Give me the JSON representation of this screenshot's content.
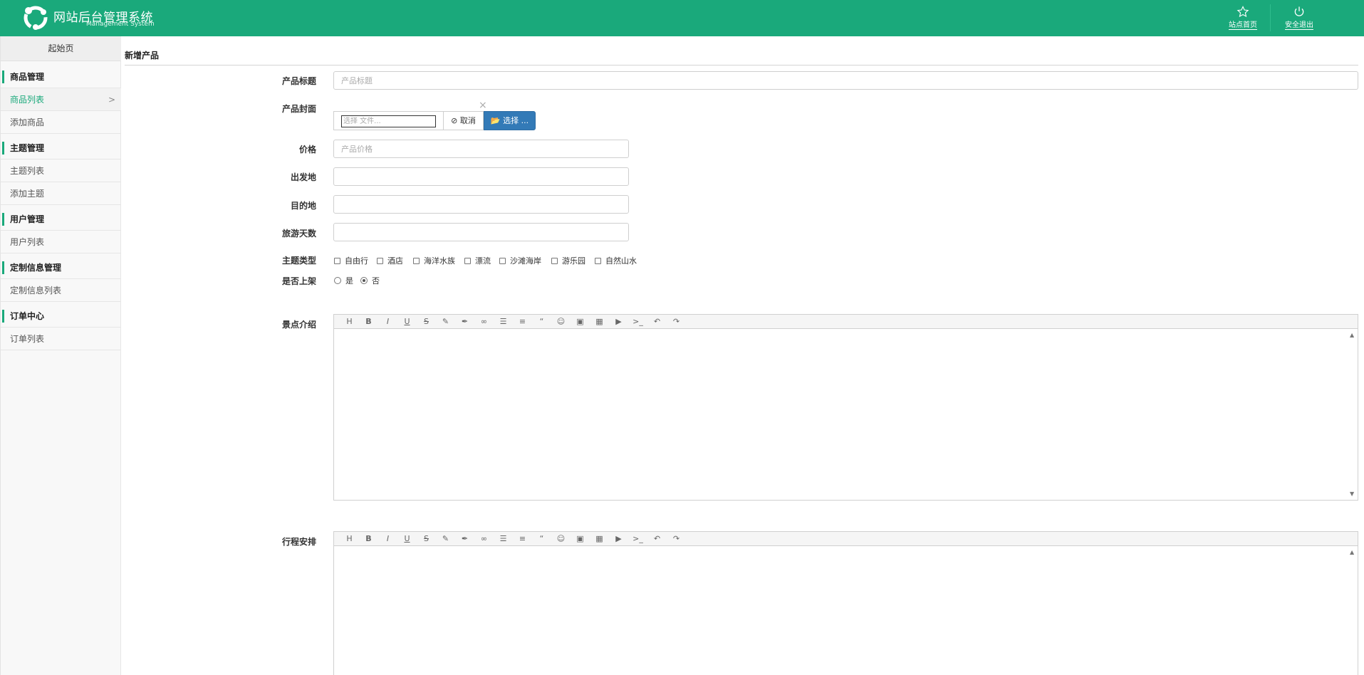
{
  "header": {
    "title": "网站后台管理系统",
    "subtitle": "Management System",
    "actions": [
      {
        "label": "站点首页",
        "icon": "star-icon"
      },
      {
        "label": "安全退出",
        "icon": "power-icon"
      }
    ]
  },
  "sidebar": {
    "home_tab": "起始页",
    "groups": [
      {
        "title": "商品管理",
        "items": [
          "商品列表",
          "添加商品"
        ]
      },
      {
        "title": "主题管理",
        "items": [
          "主题列表",
          "添加主题"
        ]
      },
      {
        "title": "用户管理",
        "items": [
          "用户列表"
        ]
      },
      {
        "title": "定制信息管理",
        "items": [
          "定制信息列表"
        ]
      },
      {
        "title": "订单中心",
        "items": [
          "订单列表"
        ]
      }
    ],
    "active_item": "商品列表"
  },
  "main": {
    "page_title": "新增产品",
    "fields": {
      "title": {
        "label": "产品标题",
        "placeholder": "产品标题",
        "value": ""
      },
      "cover": {
        "label": "产品封面",
        "placeholder": "选择 文件...",
        "cancel_label": "取消",
        "choose_label": "选择 ...",
        "clear_symbol": "×"
      },
      "price": {
        "label": "价格",
        "placeholder": "产品价格",
        "value": ""
      },
      "origin": {
        "label": "出发地",
        "value": ""
      },
      "destination": {
        "label": "目的地",
        "value": ""
      },
      "days": {
        "label": "旅游天数",
        "value": ""
      },
      "themes": {
        "label": "主题类型",
        "options": [
          "自由行",
          "酒店",
          "海洋水族",
          "漂流",
          "沙滩海岸",
          "游乐园",
          "自然山水"
        ],
        "checked": []
      },
      "on_shelf": {
        "label": "是否上架",
        "options": [
          "是",
          "否"
        ],
        "selected": "否"
      },
      "intro": {
        "label": "景点介绍"
      },
      "itinerary": {
        "label": "行程安排"
      }
    },
    "toolbar_icons": [
      "heading-icon",
      "bold-icon",
      "italic-icon",
      "underline-icon",
      "strikethrough-icon",
      "highlight-icon",
      "brush-icon",
      "link-icon",
      "list-icon",
      "align-icon",
      "quote-icon",
      "emoji-icon",
      "image-icon",
      "table-icon",
      "video-icon",
      "code-icon",
      "undo-icon",
      "redo-icon"
    ]
  },
  "colors": {
    "brand": "#1aa97b",
    "primary_button": "#337ab7"
  }
}
